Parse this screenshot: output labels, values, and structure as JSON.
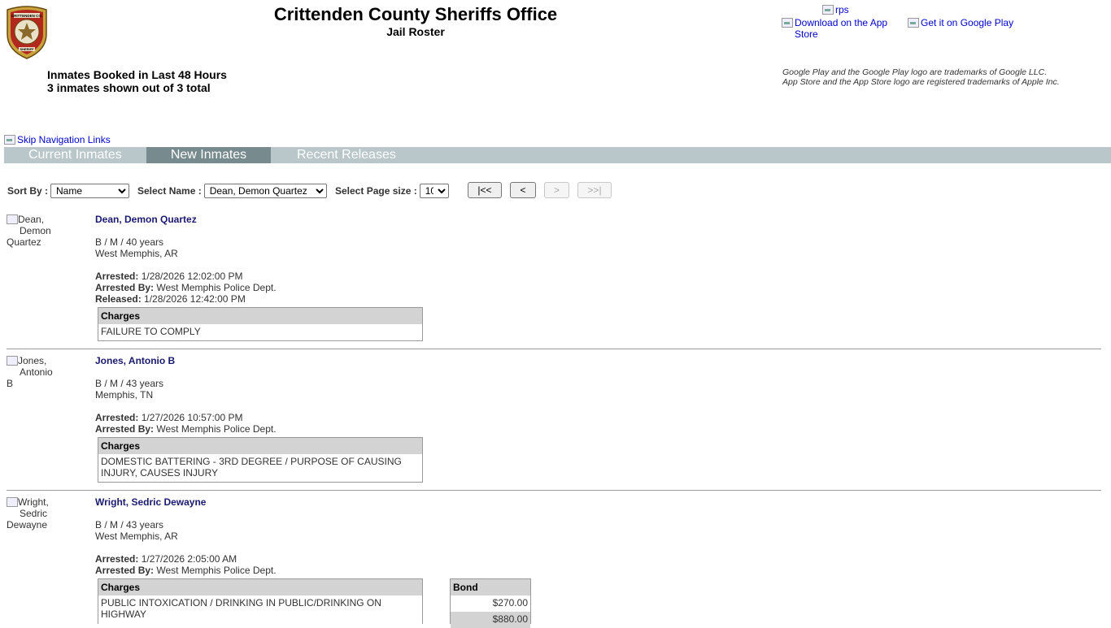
{
  "header": {
    "title": "Crittenden County Sheriffs Office",
    "subtitle": "Jail Roster",
    "logo_text_top": "CRITTENDEN CO.",
    "logo_text_bottom": "SHERIFF",
    "booked_line1": "Inmates Booked in Last 48 Hours",
    "booked_line2": "3 inmates shown out of 3 total",
    "rps_alt": "rps",
    "app_store_alt": "Download on the App Store",
    "google_play_alt": "Get it on Google Play",
    "trademark1": "Google Play and the Google Play logo are trademarks of Google LLC.",
    "trademark2": "App Store and the App Store logo are registered trademarks of Apple Inc."
  },
  "nav": {
    "skip_alt": "Skip Navigation Links",
    "tabs": [
      "Current Inmates",
      "New Inmates",
      "Recent Releases"
    ],
    "active_tab": "New Inmates"
  },
  "controls": {
    "sort_label": "Sort By :",
    "sort_value": "Name",
    "name_label": "Select Name :",
    "name_value": "Dean, Demon Quartez",
    "page_size_label": "Select Page size :",
    "page_size_value": "10",
    "first_btn": "|<<",
    "prev_btn": "<",
    "next_btn": ">",
    "last_btn": ">>|"
  },
  "labels": {
    "arrested": "Arrested:",
    "arrested_by": "Arrested By:",
    "released": "Released:",
    "charges": "Charges",
    "bond": "Bond"
  },
  "inmates": [
    {
      "name": "Dean, Demon Quartez",
      "photo_alt_lines": [
        "Dean,",
        "Demon",
        "Quartez"
      ],
      "demographics": "B / M / 40 years",
      "city": "West Memphis, AR",
      "arrested": "1/28/2026 12:02:00 PM",
      "arrested_by": "West Memphis Police Dept.",
      "released": "1/28/2026 12:42:00 PM",
      "charges": [
        "FAILURE TO COMPLY"
      ]
    },
    {
      "name": "Jones, Antonio B",
      "photo_alt_lines": [
        "Jones,",
        "Antonio B"
      ],
      "demographics": "B / M / 43 years",
      "city": "Memphis, TN",
      "arrested": "1/27/2026 10:57:00 PM",
      "arrested_by": "West Memphis Police Dept.",
      "charges": [
        "DOMESTIC BATTERING - 3RD DEGREE / PURPOSE OF CAUSING INJURY, CAUSES INJURY"
      ]
    },
    {
      "name": "Wright, Sedric Dewayne",
      "photo_alt_lines": [
        "Wright,",
        "Sedric",
        "Dewayne"
      ],
      "demographics": "B / M / 43 years",
      "city": "West Memphis, AR",
      "arrested": "1/27/2026 2:05:00 AM",
      "arrested_by": "West Memphis Police Dept.",
      "charges": [
        "PUBLIC INTOXICATION / DRINKING IN PUBLIC/DRINKING ON HIGHWAY"
      ],
      "bonds": [
        "$270.00",
        "$880.00"
      ]
    }
  ],
  "colors": {
    "nav_bar": "#b9c7cb",
    "nav_active": "#778a8e",
    "name_link": "#1a1a6e",
    "table_header": "#d3d3d3"
  }
}
